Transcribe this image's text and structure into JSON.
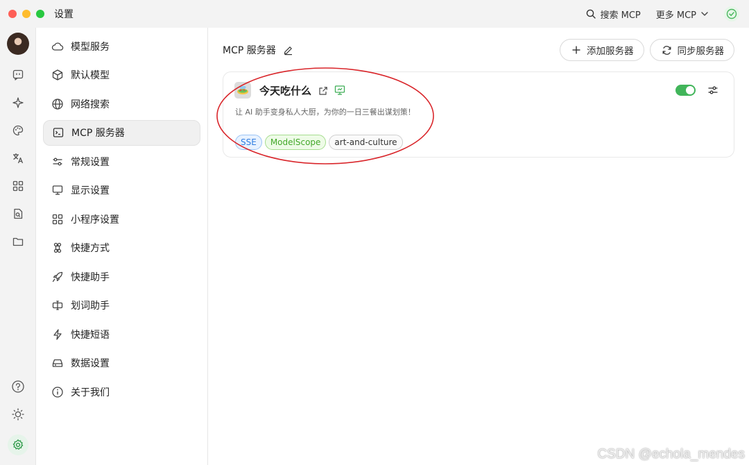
{
  "window": {
    "title": "设置"
  },
  "titlebar": {
    "search_label": "搜索 MCP",
    "more_label": "更多 MCP"
  },
  "nav": {
    "items": [
      {
        "label": "模型服务",
        "icon": "cloud-icon"
      },
      {
        "label": "默认模型",
        "icon": "cube-icon"
      },
      {
        "label": "网络搜索",
        "icon": "globe-icon"
      },
      {
        "label": "MCP 服务器",
        "icon": "terminal-icon",
        "active": true
      },
      {
        "label": "常规设置",
        "icon": "sliders-icon"
      },
      {
        "label": "显示设置",
        "icon": "monitor-icon"
      },
      {
        "label": "小程序设置",
        "icon": "grid-icon"
      },
      {
        "label": "快捷方式",
        "icon": "command-icon"
      },
      {
        "label": "快捷助手",
        "icon": "rocket-icon"
      },
      {
        "label": "划词助手",
        "icon": "text-cursor-icon"
      },
      {
        "label": "快捷短语",
        "icon": "zap-icon"
      },
      {
        "label": "数据设置",
        "icon": "drive-icon"
      },
      {
        "label": "关于我们",
        "icon": "info-icon"
      }
    ]
  },
  "main": {
    "title": "MCP 服务器",
    "add_label": "添加服务器",
    "sync_label": "同步服务器",
    "server": {
      "name": "今天吃什么",
      "description": "让 AI 助手变身私人大厨，为你的一日三餐出谋划策！",
      "enabled": true,
      "tags": [
        "SSE",
        "ModelScope",
        "art-and-culture"
      ]
    }
  },
  "watermark": "CSDN @echola_mendes",
  "colors": {
    "accent_green": "#41b55a",
    "annotation_red": "#d9252a",
    "tag_blue": "#2f7de0",
    "tag_green": "#43a82a"
  }
}
